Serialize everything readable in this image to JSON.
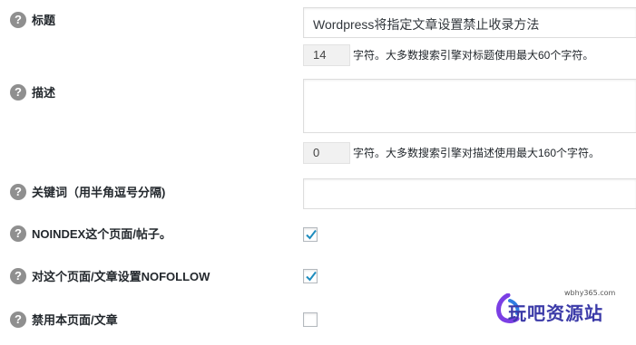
{
  "fields": {
    "title": {
      "label": "标题",
      "value": "Wordpress将指定文章设置禁止收录方法",
      "count": "14",
      "hint": "字符。大多数搜索引擎对标题使用最大60个字符。"
    },
    "description": {
      "label": "描述",
      "value": "",
      "count": "0",
      "hint": "字符。大多数搜索引擎对描述使用最大160个字符。"
    },
    "keywords": {
      "label": "关键词（用半角逗号分隔)",
      "value": ""
    },
    "noindex": {
      "label": "NOINDEX这个页面/帖子。",
      "checked": true
    },
    "nofollow": {
      "label": "对这个页面/文章设置NOFOLLOW",
      "checked": true
    },
    "disable": {
      "label": "禁用本页面/文章",
      "checked": false
    }
  },
  "help_icon_glyph": "?",
  "colors": {
    "help_icon_bg": "#8f8f8f",
    "checkmark": "#1e8cbe",
    "watermark": "#3b3aa8"
  },
  "watermark": {
    "url": "wbhy365.com",
    "text": "玩吧资源站"
  }
}
